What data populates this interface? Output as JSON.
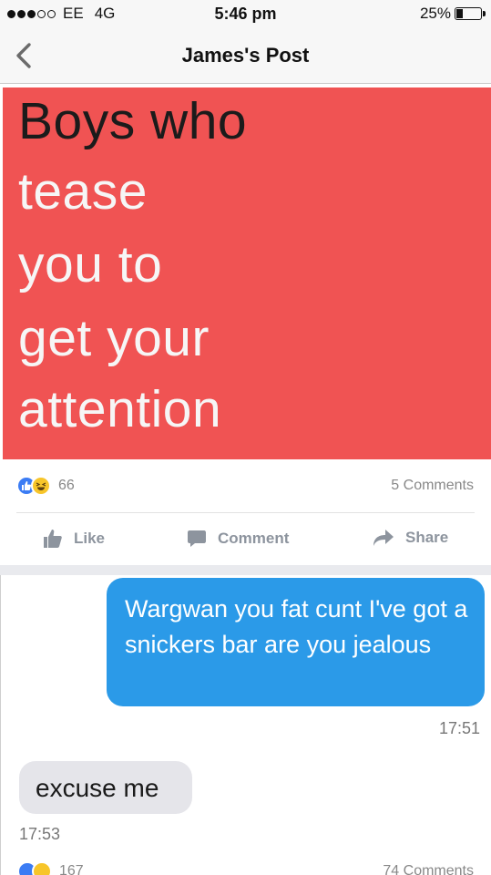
{
  "status_bar": {
    "carrier": "EE",
    "network": "4G",
    "time": "5:46 pm",
    "battery": "25%",
    "signal_level": "3/5",
    "battery_level": 0.25
  },
  "nav": {
    "title": "James's Post"
  },
  "post": {
    "image_text": [
      "Boys who",
      "tease",
      "you to",
      "get your",
      "attention"
    ],
    "reaction_count": "66",
    "comments_count": "5 Comments",
    "actions": {
      "like": "Like",
      "comment": "Comment",
      "share": "Share"
    }
  },
  "chat": {
    "outgoing_message": "Wargwan you fat cunt I've got a snickers bar are you jealous",
    "outgoing_time": "17:51",
    "incoming_message": "excuse me",
    "incoming_time": "17:53"
  },
  "next_post": {
    "reaction_count": "167",
    "comments_count": "74 Comments"
  },
  "colors": {
    "image_background": "#f05353",
    "message_blue": "#2b9ae8",
    "message_grey": "#e5e5ea",
    "like_blue": "#3b7cf4"
  }
}
